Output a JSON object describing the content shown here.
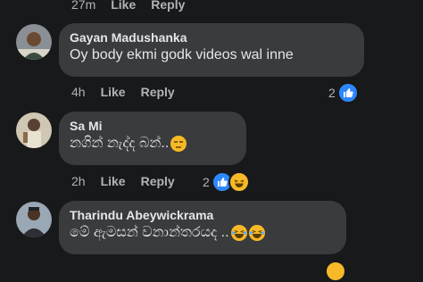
{
  "top_meta": {
    "time": "27m",
    "like": "Like",
    "reply": "Reply"
  },
  "comments": [
    {
      "author": "Gayan Madushanka",
      "text": "Oy body ekmi godk videos wal inne",
      "time": "4h",
      "like": "Like",
      "reply": "Reply",
      "reaction_count": "2",
      "reactions": [
        "like-icon"
      ]
    },
    {
      "author": "Sa Mi",
      "text": "නගින් නැද්ද බන්..",
      "emoji": "unamused-face",
      "time": "2h",
      "like": "Like",
      "reply": "Reply",
      "reaction_count": "2",
      "reactions": [
        "like-icon",
        "haha-icon"
      ]
    },
    {
      "author": "Tharindu Abeywickrama",
      "text": "මේ ඇමසන් වනාන්තරයද ..",
      "emoji": "laughing-face",
      "reactions": [
        "haha-icon"
      ]
    }
  ],
  "colors": {
    "background": "#18191a",
    "bubble": "#3a3b3c",
    "like": "#2d88ff",
    "haha": "#f7b928",
    "meta": "#b0b3b8"
  }
}
